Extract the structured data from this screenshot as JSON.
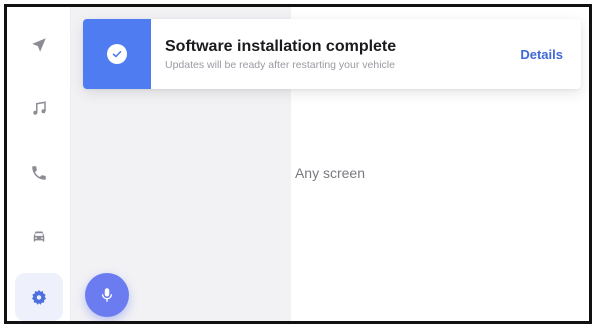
{
  "rail": {
    "items": [
      {
        "name": "navigation",
        "icon": "navigation-arrow-icon"
      },
      {
        "name": "music",
        "icon": "music-note-icon"
      },
      {
        "name": "phone",
        "icon": "phone-icon"
      },
      {
        "name": "vehicle",
        "icon": "car-icon"
      },
      {
        "name": "settings",
        "icon": "gear-icon",
        "active": true
      }
    ]
  },
  "notification": {
    "title": "Software installation complete",
    "subtitle": "Updates will be ready after restarting your vehicle",
    "action": "Details",
    "icon": "check-circle-icon",
    "accent": "#4f7df1"
  },
  "main": {
    "placeholder": "Any screen"
  },
  "voice": {
    "icon": "microphone-icon",
    "color": "#6b7cf0"
  },
  "colors": {
    "icon_gray": "#8c8c94",
    "active_icon": "#4f6fe0",
    "side_panel": "#f2f2f5"
  }
}
